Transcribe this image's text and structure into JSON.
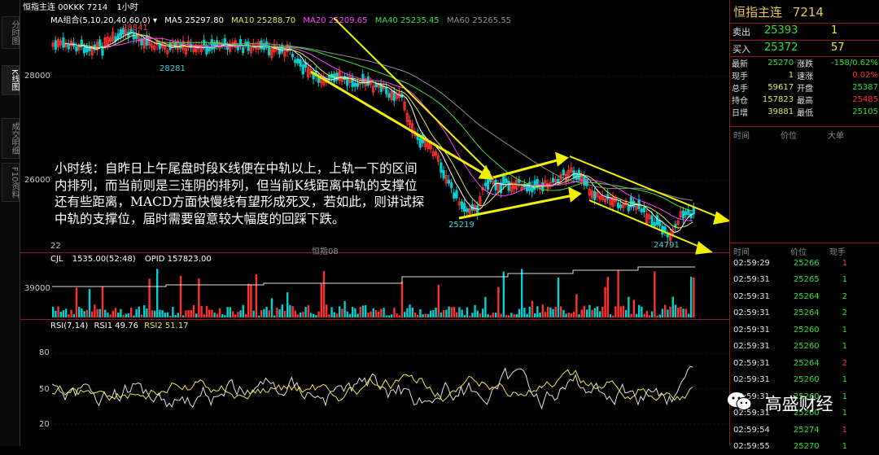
{
  "header": {
    "title": "恒指主连 00KKK 7214",
    "period": "1小时",
    "ma_group": "MA组合(5,10,20,40,60,0)",
    "ma5": "MA5 25297.80",
    "ma10": "MA10 25288.70",
    "ma20": "MA20 25209.65",
    "ma40": "MA40 25235.45",
    "ma60": "MA60 25265.55"
  },
  "left_tabs": [
    "分时图",
    "K线图",
    "成交明细",
    "F10资料"
  ],
  "price_axis": {
    "labels": [
      "28000",
      "26000"
    ],
    "high_marker": "28841",
    "low_marker1": "28281",
    "low_marker2": "25219",
    "low_marker3": "24791",
    "small1": "22",
    "small2": "恒指08"
  },
  "volume_panel": {
    "label1": "CJL",
    "label2": "1535.00(52:48)",
    "label3": "OPID 157823.00",
    "axis": "39000"
  },
  "rsi_panel": {
    "label1": "RSI(7,14)",
    "label2": "RSI1 49.76",
    "label3": "RSI2 51.17",
    "axis": [
      "80",
      "50",
      "20"
    ]
  },
  "annotation": "小时线：自昨日上午尾盘时段K线便在中轨以上，上轨一下的区间内排列，而当前则是三连阴的排列，但当前K线距离中轨的支撑位还有些距离，MACD方面快慢线有望形成死叉，若如此，则讲试探中轨的支撑位，届时需要留意较大幅度的回踩下跌。",
  "quote": {
    "name": "恒指主连",
    "code": "7214",
    "sell_label": "卖出",
    "sell_price": "25393",
    "sell_qty": "1",
    "buy_label": "买入",
    "buy_price": "25372",
    "buy_qty": "57",
    "rows": [
      [
        "最新",
        "25270",
        "涨跌",
        "-158/0.62%"
      ],
      [
        "现手",
        "1",
        "速涨",
        "0.02%"
      ],
      [
        "总手",
        "59617",
        "开盘",
        "25387"
      ],
      [
        "持仓",
        "157823",
        "最高",
        "25485"
      ],
      [
        "日增",
        "39881",
        "最低",
        "25105"
      ]
    ],
    "tick_headers": [
      "时间",
      "价位",
      "大单"
    ],
    "trade_headers": [
      "时间",
      "价位",
      "现手"
    ]
  },
  "trades": [
    [
      "02:59:29",
      "25266",
      "1"
    ],
    [
      "02:59:31",
      "25265",
      "1"
    ],
    [
      "02:59:31",
      "25264",
      "2"
    ],
    [
      "02:59:31",
      "25264",
      "2"
    ],
    [
      "02:59:31",
      "25260",
      "1"
    ],
    [
      "02:59:31",
      "25260",
      "1"
    ],
    [
      "02:59:31",
      "25264",
      "2"
    ],
    [
      "02:59:31",
      "25260",
      "1"
    ],
    [
      "02:59:31",
      "25260",
      "1"
    ],
    [
      "02:59:31",
      "25260",
      "1"
    ],
    [
      "02:59:54",
      "25274",
      "1"
    ],
    [
      "02:59:55",
      "25270",
      "1"
    ]
  ],
  "trade_colors": [
    "red",
    "green",
    "green",
    "green",
    "green",
    "green",
    "red",
    "green",
    "green",
    "green",
    "red",
    "green"
  ],
  "watermark": "高盛财经",
  "colors": {
    "up": "#ff3030",
    "down": "#00d0d0",
    "ma5": "#ffffff",
    "ma10": "#e8e850",
    "ma20": "#ff40ff",
    "ma40": "#40e040",
    "ma60": "#909090",
    "arrow": "#f0f000",
    "frame": "#8b1a1a"
  }
}
